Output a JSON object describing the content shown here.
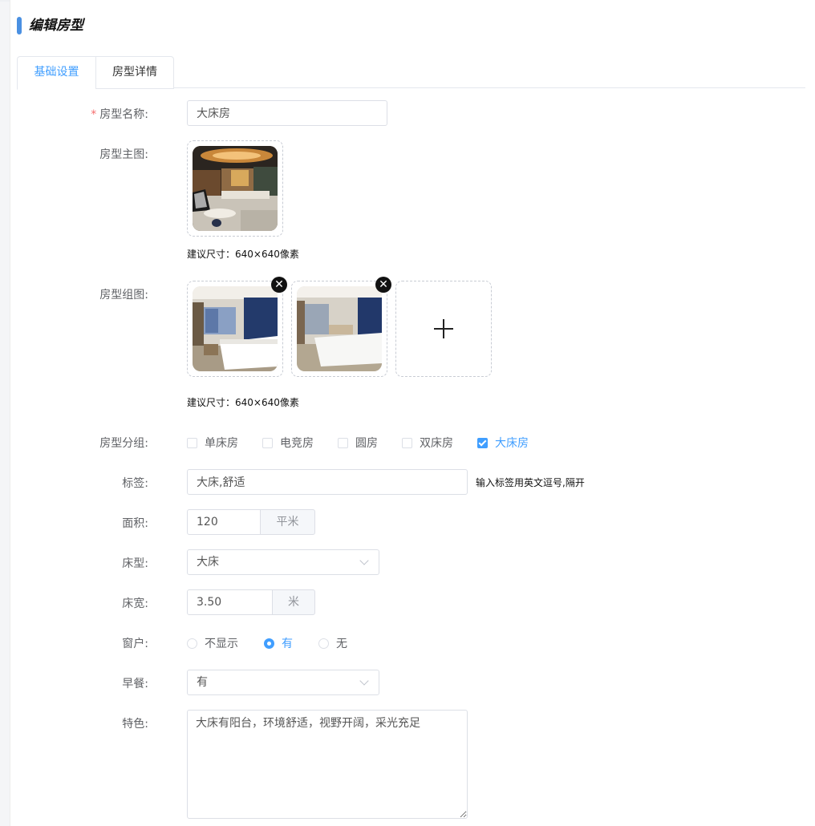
{
  "page": {
    "title": "编辑房型"
  },
  "tabs": [
    {
      "label": "基础设置",
      "active": true
    },
    {
      "label": "房型详情",
      "active": false
    }
  ],
  "form": {
    "name": {
      "label": "房型名称:",
      "value": "大床房",
      "required": true
    },
    "main_image": {
      "label": "房型主图:",
      "hint": "建议尺寸：640×640像素"
    },
    "gallery": {
      "label": "房型组图:",
      "hint": "建议尺寸：640×640像素"
    },
    "group": {
      "label": "房型分组:",
      "options": [
        {
          "label": "单床房",
          "checked": false
        },
        {
          "label": "电竞房",
          "checked": false
        },
        {
          "label": "圆房",
          "checked": false
        },
        {
          "label": "双床房",
          "checked": false
        },
        {
          "label": "大床房",
          "checked": true
        }
      ]
    },
    "tags": {
      "label": "标签:",
      "value": "大床,舒适",
      "hint": "输入标签用英文逗号,隔开"
    },
    "area": {
      "label": "面积:",
      "value": "120",
      "unit": "平米"
    },
    "bed_type": {
      "label": "床型:",
      "value": "大床"
    },
    "bed_width": {
      "label": "床宽:",
      "value": "3.50",
      "unit": "米"
    },
    "window": {
      "label": "窗户:",
      "options": [
        {
          "label": "不显示",
          "checked": false
        },
        {
          "label": "有",
          "checked": true
        },
        {
          "label": "无",
          "checked": false
        }
      ]
    },
    "breakfast": {
      "label": "早餐:",
      "value": "有"
    },
    "feature": {
      "label": "特色:",
      "value": "大床有阳台，环境舒适，视野开阔，采光充足"
    }
  },
  "colors": {
    "accent": "#409eff",
    "title_bar": "#4a90e2",
    "required": "#f56c6c"
  }
}
